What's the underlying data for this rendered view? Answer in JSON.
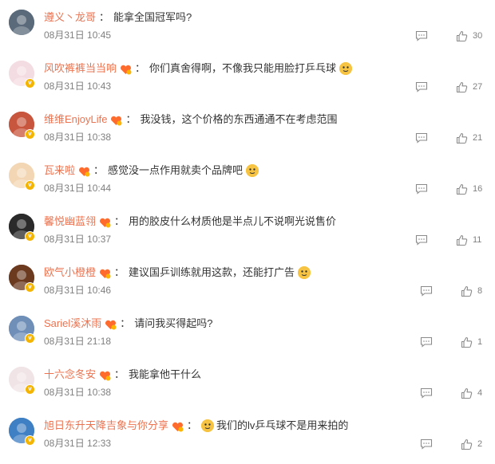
{
  "comments": [
    {
      "user": "遵义丶龙哥",
      "text": "能拿全国冠军吗?",
      "time": "08月31日 10:45",
      "likes": "30",
      "badge_v": false,
      "vip": false,
      "emoji": false,
      "avatar_color": "#5a6a7a"
    },
    {
      "user": "风吹裤裤当当响",
      "text": "你们真舍得啊，不像我只能用脸打乒乓球",
      "time": "08月31日 10:43",
      "likes": "27",
      "badge_v": true,
      "vip": true,
      "emoji": true,
      "avatar_color": "#f4dde2"
    },
    {
      "user": "维维EnjoyLife",
      "text": "我没钱，这个价格的东西通通不在考虑范围",
      "time": "08月31日 10:38",
      "likes": "21",
      "badge_v": true,
      "vip": true,
      "emoji": false,
      "avatar_color": "#c8553d"
    },
    {
      "user": "瓦来啦",
      "text": "感觉没一点作用就卖个品牌吧",
      "time": "08月31日 10:44",
      "likes": "16",
      "badge_v": true,
      "vip": true,
      "emoji": true,
      "avatar_color": "#f3d7b5"
    },
    {
      "user": "馨悦幽蓝翎",
      "text": "用的胶皮什么材质他是半点儿不说啊光说售价",
      "time": "08月31日 10:37",
      "likes": "11",
      "badge_v": true,
      "vip": true,
      "emoji": false,
      "avatar_color": "#2a2a2a"
    },
    {
      "user": "欧气小橙橙",
      "text": "建议国乒训练就用这款，还能打广告",
      "time": "08月31日 10:46",
      "likes": "8",
      "badge_v": true,
      "vip": true,
      "emoji": true,
      "avatar_color": "#6b3a1f"
    },
    {
      "user": "Sariel溪沐雨",
      "text": "请问我买得起吗?",
      "time": "08月31日 21:18",
      "likes": "1",
      "badge_v": true,
      "vip": true,
      "emoji": false,
      "avatar_color": "#6f8fb8"
    },
    {
      "user": "十六念冬安",
      "text": "我能拿他干什么",
      "time": "08月31日 10:38",
      "likes": "4",
      "badge_v": true,
      "vip": true,
      "emoji": false,
      "avatar_color": "#f1e4e6"
    },
    {
      "user": "旭日东升天降吉象与你分享",
      "text": "我们的lv乒乓球不是用来拍的",
      "time": "08月31日 12:33",
      "likes": "2",
      "badge_v": true,
      "vip": true,
      "emoji": true,
      "emoji_before": true,
      "avatar_color": "#3f7fc4"
    }
  ],
  "icons": {
    "reply": "comment-icon",
    "like": "thumbs-up-icon",
    "vip": "vip-heart-icon",
    "emoji": "doge-emoji-icon"
  },
  "colors": {
    "username": "#eb7350",
    "text": "#333333",
    "meta": "#808080",
    "verified": "#f5b400"
  }
}
